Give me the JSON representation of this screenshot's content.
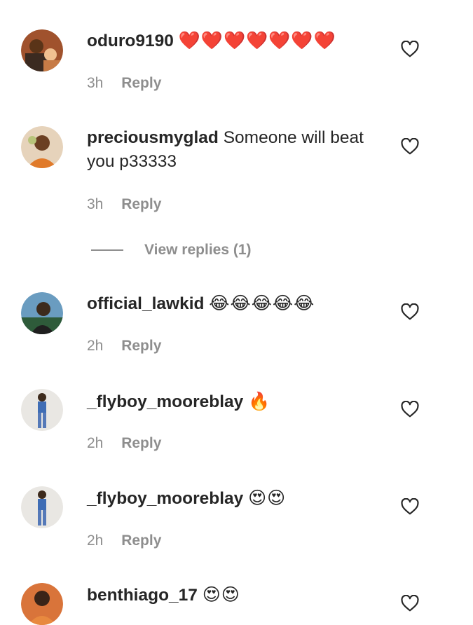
{
  "comments": [
    {
      "username": "oduro9190",
      "text": "",
      "emoji": "❤️❤️❤️❤️❤️❤️❤️",
      "time": "3h",
      "reply_label": "Reply",
      "avatar_colors": [
        "#b5651d",
        "#f0c090"
      ]
    },
    {
      "username": "preciousmyglad",
      "text": "Someone will beat you p33333",
      "emoji": "",
      "time": "3h",
      "reply_label": "Reply",
      "avatar_colors": [
        "#e8d6c0",
        "#7a4a2a"
      ]
    },
    {
      "username": "official_lawkid",
      "text": "",
      "emoji": "😂😂😂😂😂",
      "time": "2h",
      "reply_label": "Reply",
      "avatar_colors": [
        "#5a8fb0",
        "#3d2a1c"
      ]
    },
    {
      "username": "_flyboy_mooreblay",
      "text": "",
      "emoji": "🔥",
      "time": "2h",
      "reply_label": "Reply",
      "avatar_colors": [
        "#e8e6e2",
        "#3f6db5"
      ]
    },
    {
      "username": "_flyboy_mooreblay",
      "text": "",
      "emoji": "😍😍",
      "time": "2h",
      "reply_label": "Reply",
      "avatar_colors": [
        "#e8e6e2",
        "#3f6db5"
      ]
    },
    {
      "username": "benthiago_17",
      "text": "",
      "emoji": "😍😍",
      "time": "",
      "reply_label": "",
      "avatar_colors": [
        "#d9743a",
        "#3a2418"
      ]
    }
  ],
  "view_replies_label": "View replies (1)",
  "colors": {
    "text": "#262626",
    "muted": "#8e8e8e",
    "background": "#ffffff"
  }
}
